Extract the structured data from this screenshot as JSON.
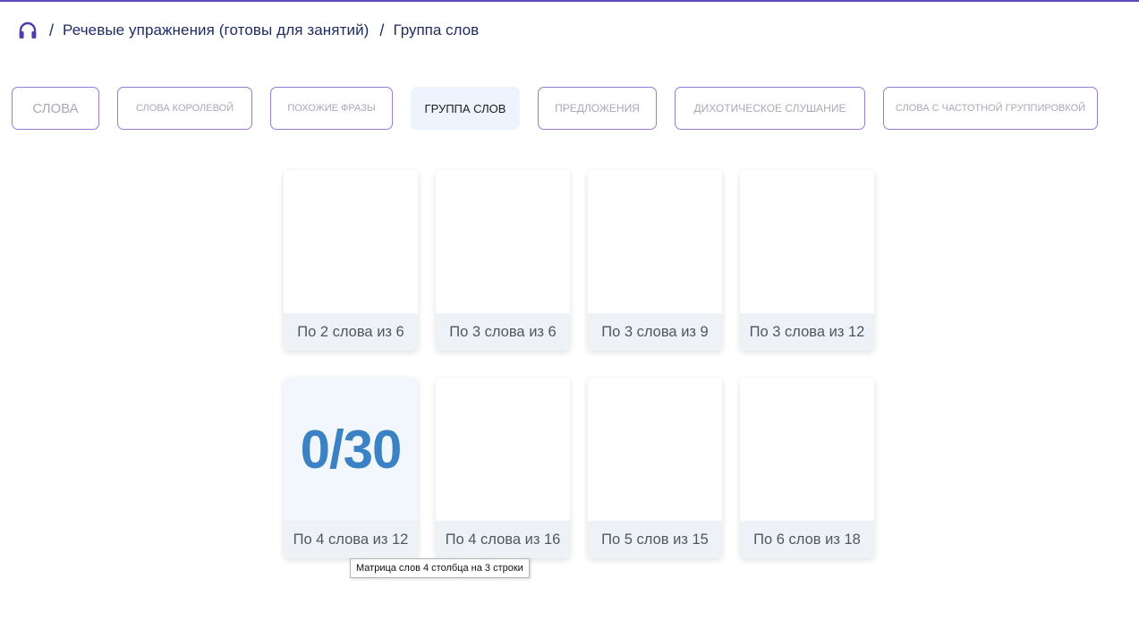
{
  "breadcrumb": {
    "home_icon": "headphones-icon",
    "separator": "/",
    "section": "Речевые упражнения (готовы для занятий)",
    "current": "Группа слов"
  },
  "tabs": [
    {
      "label": "Слова",
      "active": false
    },
    {
      "label": "Слова королевой",
      "active": false
    },
    {
      "label": "Похожие фразы",
      "active": false
    },
    {
      "label": "Группа слов",
      "active": true
    },
    {
      "label": "Предложения",
      "active": false
    },
    {
      "label": "Дихотическое слушание",
      "active": false
    },
    {
      "label": "Слова с частотной группировкой",
      "active": false
    }
  ],
  "cards": [
    {
      "label": "По 2 слова из 6",
      "score": ""
    },
    {
      "label": "По 3 слова из 6",
      "score": ""
    },
    {
      "label": "По 3 слова из 9",
      "score": ""
    },
    {
      "label": "По 3 слова из 12",
      "score": ""
    },
    {
      "label": "По 4 слова из 12",
      "score": "0/30"
    },
    {
      "label": "По 4 слова из 16",
      "score": ""
    },
    {
      "label": "По 5 слов из 15",
      "score": ""
    },
    {
      "label": "По 6 слов из 18",
      "score": ""
    }
  ],
  "tooltip": {
    "text": "Матрица слов 4 столбца на 3 строки"
  },
  "colors": {
    "accent": "#5c4cc4",
    "tab_border": "#9a7ad6",
    "active_tab_bg": "#edf4fd",
    "score": "#3b82c4",
    "breadcrumb_text": "#1d2a5e"
  }
}
